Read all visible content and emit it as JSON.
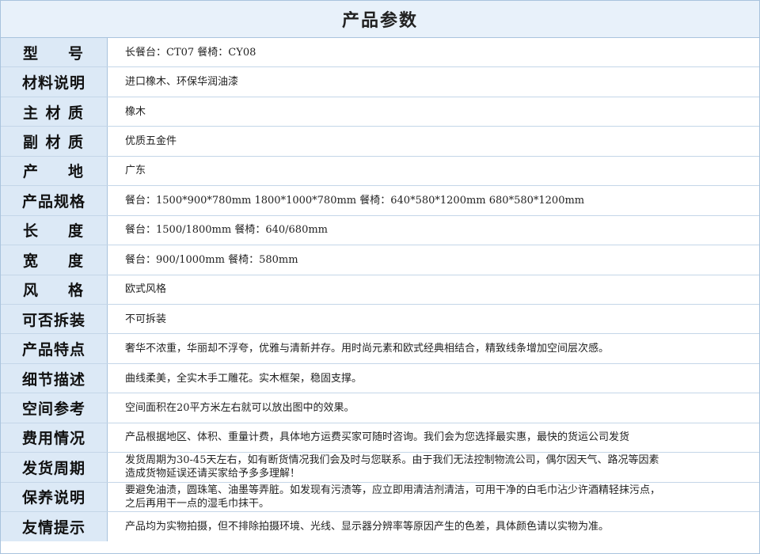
{
  "title": "产品参数",
  "rows": [
    {
      "label": "型号",
      "spaced": true,
      "value": "长餐台：CT07  餐椅：CY08"
    },
    {
      "label": "材料说明",
      "spaced": false,
      "value": "进口橡木、环保华润油漆"
    },
    {
      "label": "主材质",
      "spaced": true,
      "value": "橡木"
    },
    {
      "label": "副材质",
      "spaced": true,
      "value": "优质五金件"
    },
    {
      "label": "产地",
      "spaced": true,
      "value": "广东"
    },
    {
      "label": "产品规格",
      "spaced": false,
      "value": "餐台：1500*900*780mm  1800*1000*780mm  餐椅：640*580*1200mm  680*580*1200mm"
    },
    {
      "label": "长度",
      "spaced": true,
      "value": "餐台：1500/1800mm  餐椅：640/680mm"
    },
    {
      "label": "宽度",
      "spaced": true,
      "value": "餐台：900/1000mm  餐椅：580mm"
    },
    {
      "label": "风格",
      "spaced": true,
      "value": "欧式风格"
    },
    {
      "label": "可否拆装",
      "spaced": false,
      "value": "不可拆装"
    },
    {
      "label": "产品特点",
      "spaced": false,
      "value": "奢华不浓重，华丽却不浮夸，优雅与清新并存。用时尚元素和欧式经典相结合，精致线条增加空间层次感。"
    },
    {
      "label": "细节描述",
      "spaced": false,
      "value": "曲线柔美，全实木手工雕花。实木框架，稳固支撑。"
    },
    {
      "label": "空间参考",
      "spaced": false,
      "value": "空间面积在20平方米左右就可以放出图中的效果。"
    },
    {
      "label": "费用情况",
      "spaced": false,
      "value": "产品根据地区、体积、重量计费，具体地方运费买家可随时咨询。我们会为您选择最实惠，最快的货运公司发货"
    },
    {
      "label": "发货周期",
      "spaced": false,
      "value": "发货周期为30-45天左右，如有断货情况我们会及时与您联系。由于我们无法控制物流公司，偶尔因天气、路况等因素\n造成货物延误还请买家给予多多理解！"
    },
    {
      "label": "保养说明",
      "spaced": false,
      "value": "要避免油渍，圆珠笔、油墨等弄脏。如发现有污渍等，应立即用清洁剂清洁，可用干净的白毛巾沾少许酒精轻抹污点，\n之后再用干一点的湿毛巾抹干。"
    },
    {
      "label": "友情提示",
      "spaced": false,
      "value": "产品均为实物拍摄，但不排除拍摄环境、光线、显示器分辨率等原因产生的色差，具体颜色请以实物为准。"
    }
  ]
}
